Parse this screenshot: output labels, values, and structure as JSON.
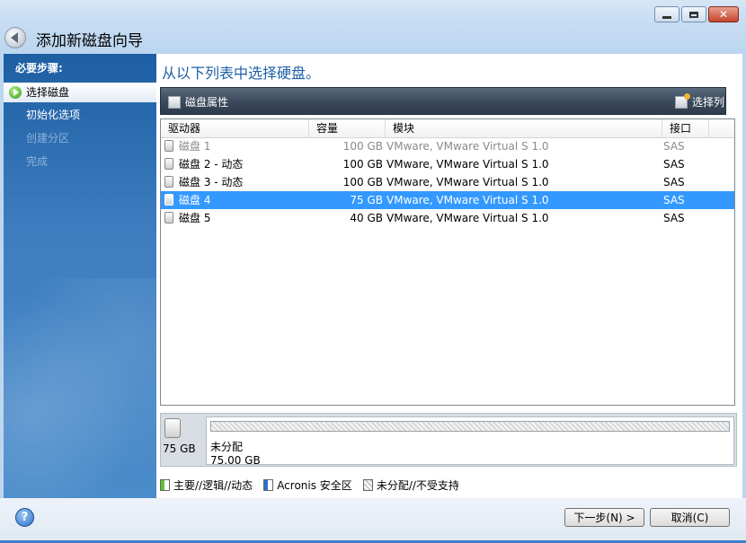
{
  "window": {
    "title": "添加新磁盘向导",
    "controls": [
      "minimize-icon",
      "maximize-icon",
      "close-icon"
    ]
  },
  "steps": {
    "header": "必要步骤:",
    "items": [
      {
        "label": "选择磁盘",
        "state": "active"
      },
      {
        "label": "初始化选项",
        "state": "link"
      },
      {
        "label": "创建分区",
        "state": "disabled"
      },
      {
        "label": "完成",
        "state": "disabled"
      }
    ]
  },
  "main": {
    "instruction": "从以下列表中选择硬盘。",
    "toolbar": {
      "disk_props": "磁盘属性",
      "choose_columns": "选择列"
    },
    "columns": [
      "驱动器",
      "容量",
      "模块",
      "接口"
    ],
    "rows": [
      {
        "drive": "磁盘 1",
        "capacity": "100 GB",
        "model": "VMware, VMware Virtual S 1.0",
        "interface": "SAS",
        "state": "disabled"
      },
      {
        "drive": "磁盘 2 - 动态",
        "capacity": "100 GB",
        "model": "VMware, VMware Virtual S 1.0",
        "interface": "SAS",
        "state": "normal"
      },
      {
        "drive": "磁盘 3 - 动态",
        "capacity": "100 GB",
        "model": "VMware, VMware Virtual S 1.0",
        "interface": "SAS",
        "state": "normal"
      },
      {
        "drive": "磁盘 4",
        "capacity": "75 GB",
        "model": "VMware, VMware Virtual S 1.0",
        "interface": "SAS",
        "state": "selected"
      },
      {
        "drive": "磁盘 5",
        "capacity": "40 GB",
        "model": "VMware, VMware Virtual S 1.0",
        "interface": "SAS",
        "state": "normal"
      }
    ],
    "diskmap": {
      "size": "75 GB",
      "partition_name": "未分配",
      "partition_capacity": "75.00 GB"
    },
    "legend": [
      {
        "label": "主要//逻辑//动态",
        "color": "#5cc23c"
      },
      {
        "label": "Acronis 安全区",
        "color": "#2f6fd0"
      },
      {
        "label": "未分配//不受支持",
        "color": "#c8c8c8"
      }
    ]
  },
  "footer": {
    "next": "下一步(N) >",
    "cancel": "取消(C)",
    "help": "?"
  }
}
